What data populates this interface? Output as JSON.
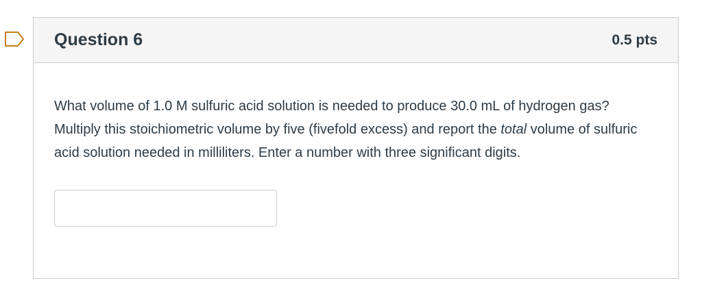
{
  "question": {
    "title": "Question 6",
    "points": "0.5 pts",
    "text_part1": "What volume of 1.0 M sulfuric acid solution is needed to produce 30.0 mL of hydrogen gas? Multiply this stoichiometric volume by five (fivefold excess) and report the ",
    "text_emphasis": "total",
    "text_part2": " volume of sulfuric acid solution needed in milliliters. Enter a number with three significant digits.",
    "answer_value": ""
  },
  "colors": {
    "text": "#2d3b45",
    "border": "#c7cdd1",
    "header_bg": "#f5f5f5",
    "flag_outline": "#c27d1c"
  },
  "icons": {
    "flag": "bookmark-flag-icon"
  }
}
